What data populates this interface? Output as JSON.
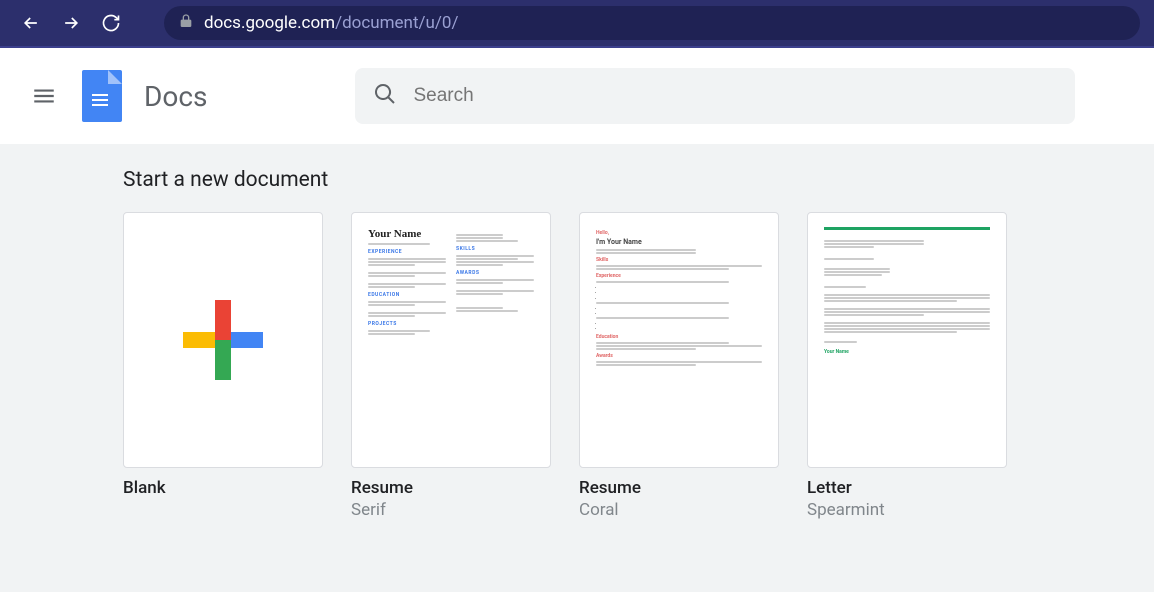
{
  "browser": {
    "url_domain": "docs.google.com",
    "url_path": "/document/u/0/"
  },
  "app": {
    "title": "Docs",
    "search_placeholder": "Search"
  },
  "templates": {
    "section_title": "Start a new document",
    "items": [
      {
        "title": "Blank",
        "subtitle": ""
      },
      {
        "title": "Resume",
        "subtitle": "Serif"
      },
      {
        "title": "Resume",
        "subtitle": "Coral"
      },
      {
        "title": "Letter",
        "subtitle": "Spearmint"
      }
    ],
    "previews": {
      "serif_name": "Your Name",
      "coral_hello": "Hello,",
      "coral_name": "I'm Your Name",
      "coral_skills": "Skills",
      "coral_experience": "Experience",
      "coral_education": "Education",
      "coral_awards": "Awards",
      "spearm_signoff": "Your Name"
    }
  }
}
